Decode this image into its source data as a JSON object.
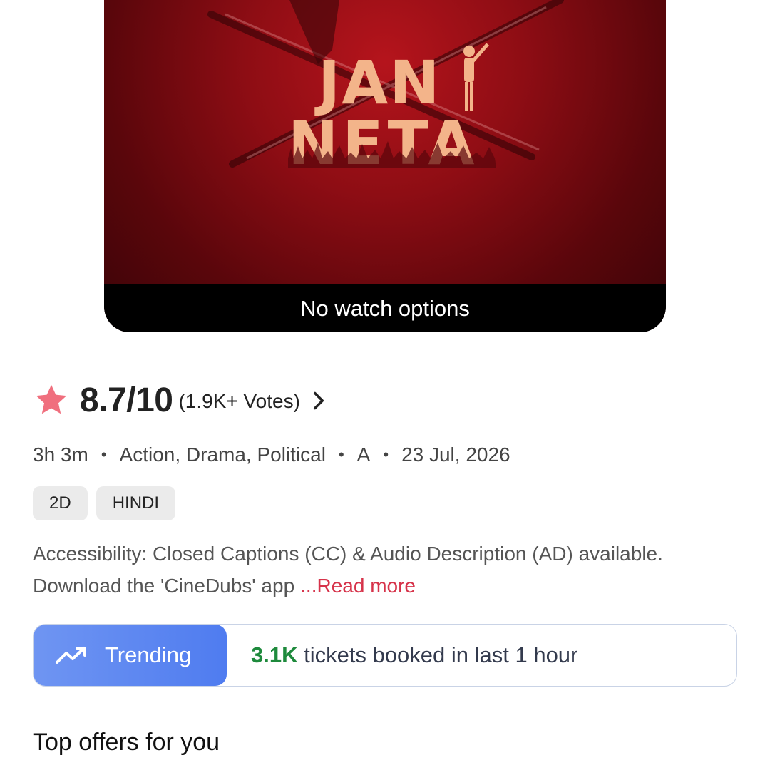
{
  "poster": {
    "title_line1": "JAN",
    "title_line2": "NETA",
    "watch_label": "No watch options"
  },
  "rating": {
    "score": "8.7/10",
    "votes": "(1.9K+ Votes)",
    "star_color": "#f06f7e"
  },
  "meta": {
    "duration": "3h 3m",
    "genres": "Action, Drama, Political",
    "certificate": "A",
    "release_date": "23 Jul, 2026",
    "separator": "•"
  },
  "tags": [
    "2D",
    "HINDI"
  ],
  "accessibility": {
    "text": "Accessibility: Closed Captions (CC) & Audio Description (AD) available. Download the 'CineDubs' app",
    "read_more": "...Read more"
  },
  "trending": {
    "label": "Trending",
    "count": "3.1K",
    "text": " tickets booked in last 1 hour",
    "accent": "#4f7cf0",
    "count_color": "#1e8a3c"
  },
  "offers": {
    "title": "Top offers for you"
  }
}
